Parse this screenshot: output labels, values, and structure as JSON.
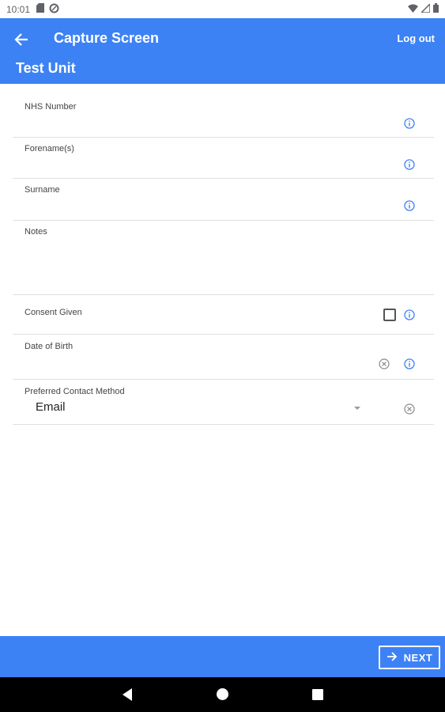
{
  "status_bar": {
    "time": "10:01",
    "icons": [
      "sd-card-icon",
      "data-saver-icon"
    ],
    "right_icons": [
      "wifi-icon",
      "signal-icon",
      "battery-icon"
    ]
  },
  "app_bar": {
    "title": "Capture Screen",
    "subtitle": "Test Unit",
    "logout_label": "Log out",
    "back_icon": "arrow-back-icon",
    "color": "#3d82f5"
  },
  "form": {
    "nhs_number": {
      "label": "NHS Number",
      "value": ""
    },
    "forenames": {
      "label": "Forename(s)",
      "value": ""
    },
    "surname": {
      "label": "Surname",
      "value": ""
    },
    "notes": {
      "label": "Notes",
      "value": ""
    },
    "consent": {
      "label": "Consent Given",
      "checked": false
    },
    "dob": {
      "label": "Date of Birth",
      "value": ""
    },
    "contact": {
      "label": "Preferred Contact Method",
      "value": "Email"
    }
  },
  "bottom_bar": {
    "next_label": "NEXT"
  },
  "accent_color": "#3d82f5"
}
